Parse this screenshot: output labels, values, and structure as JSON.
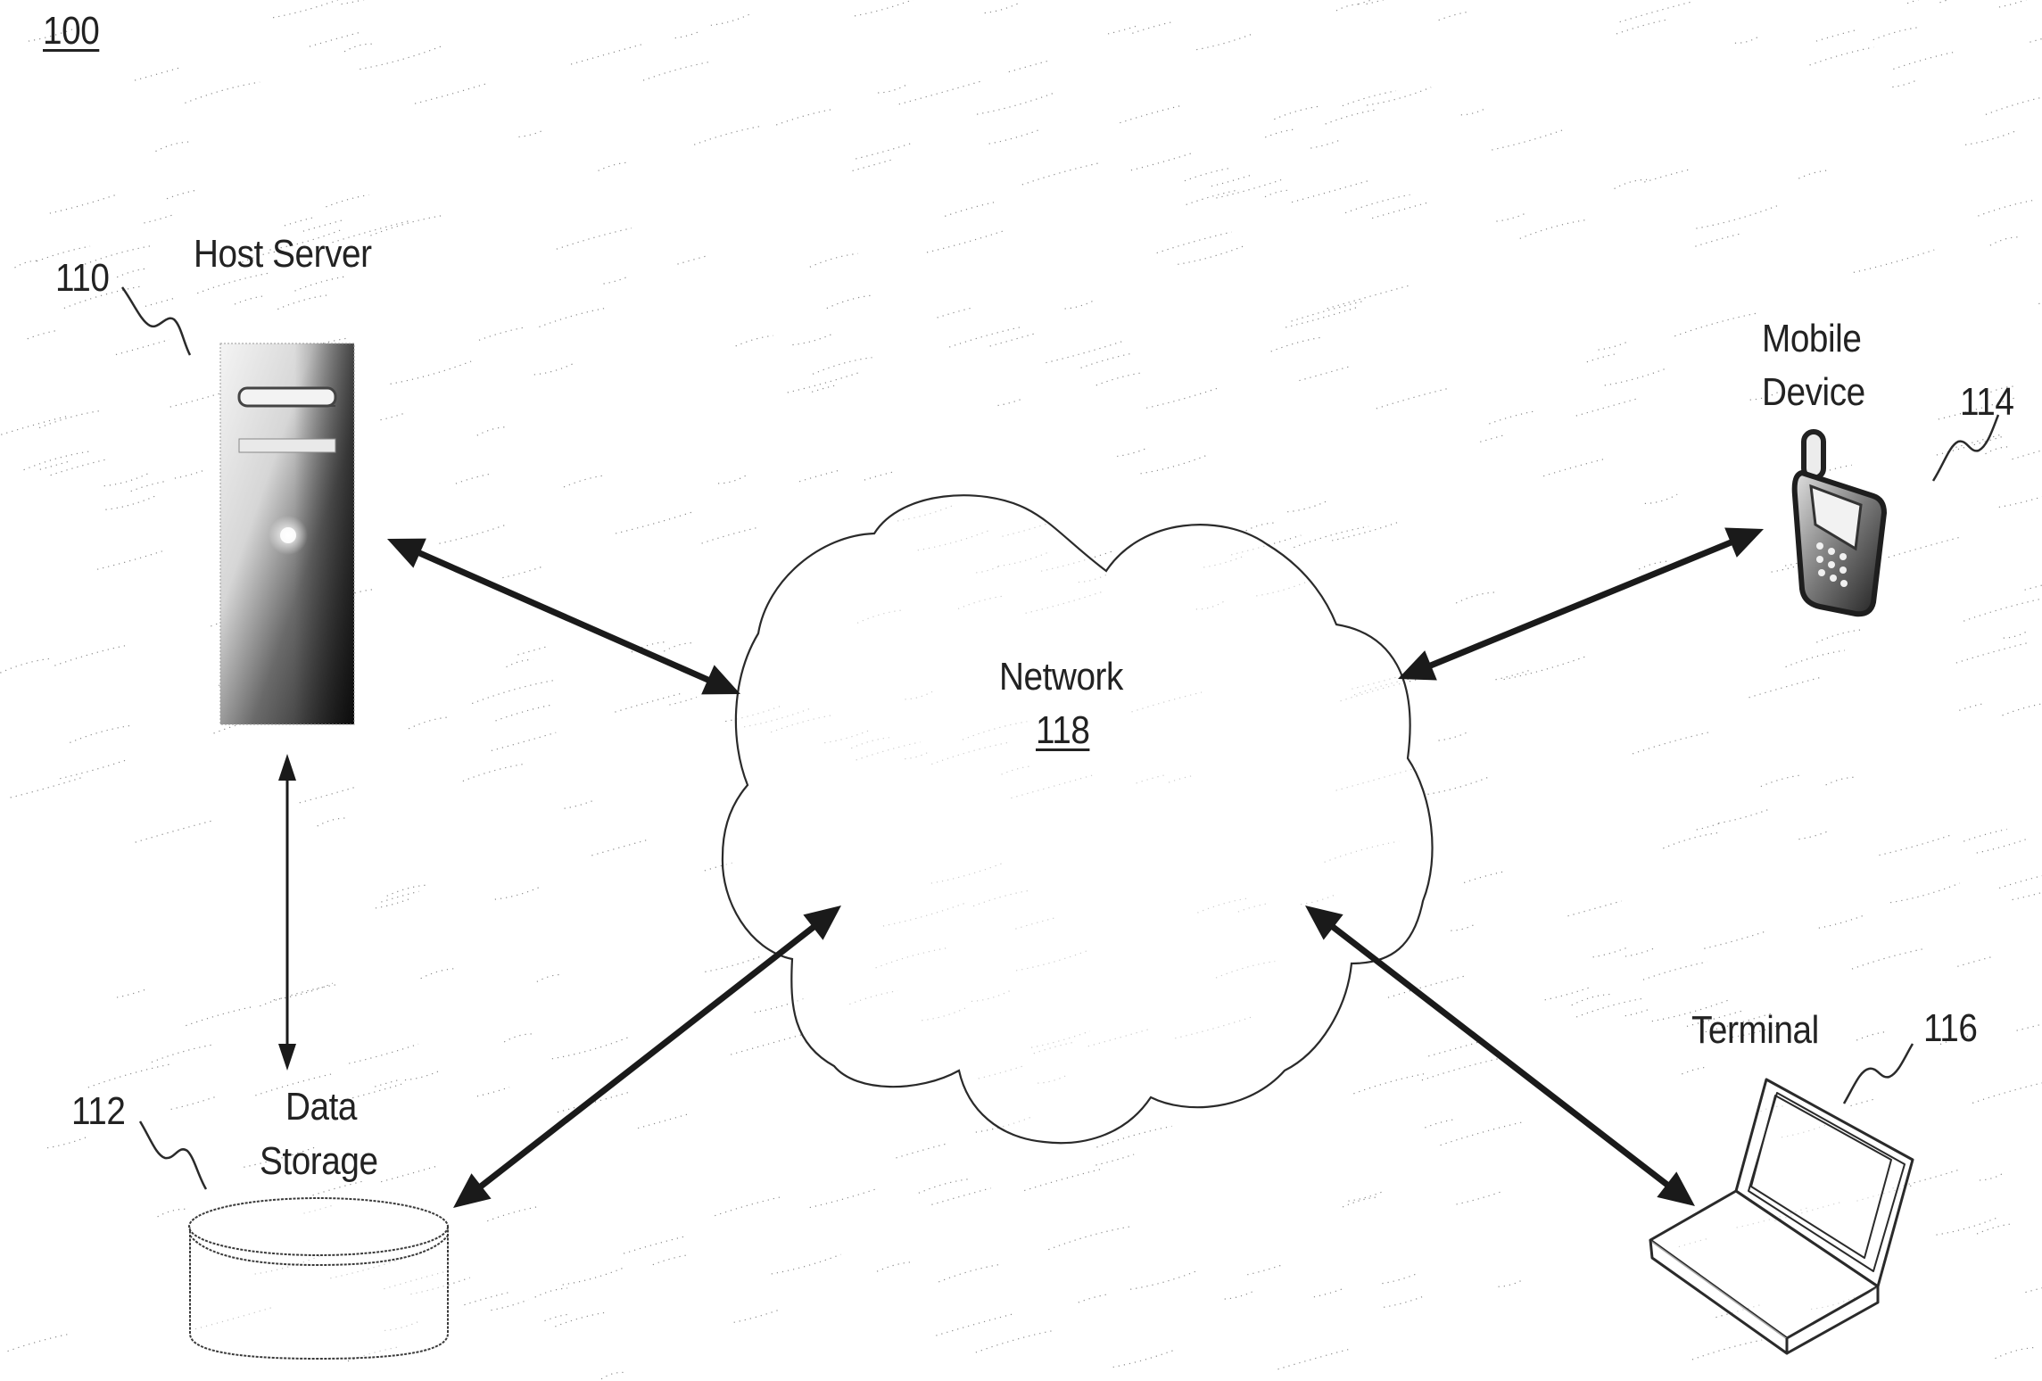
{
  "figure": {
    "number": "100",
    "colors": {
      "ink": "#1a1a1a",
      "stroke": "#2a2a2a",
      "background": "#ffffff",
      "stipple": "#8a8a8a"
    }
  },
  "nodes": {
    "host_server": {
      "label": "Host Server",
      "ref": "110",
      "icon": "server-tower-icon"
    },
    "data_storage": {
      "label_line1": "Data",
      "label_line2": "Storage",
      "ref": "112",
      "icon": "database-cylinder-icon"
    },
    "mobile_device": {
      "label_line1": "Mobile",
      "label_line2": "Device",
      "ref": "114",
      "icon": "mobile-phone-icon"
    },
    "terminal": {
      "label": "Terminal",
      "ref": "116",
      "icon": "laptop-icon"
    },
    "network": {
      "label": "Network",
      "ref": "118",
      "icon": "cloud-icon"
    }
  },
  "connections": [
    {
      "from": "host_server",
      "to": "network",
      "type": "bidirectional"
    },
    {
      "from": "host_server",
      "to": "data_storage",
      "type": "bidirectional"
    },
    {
      "from": "data_storage",
      "to": "network",
      "type": "bidirectional"
    },
    {
      "from": "mobile_device",
      "to": "network",
      "type": "bidirectional"
    },
    {
      "from": "terminal",
      "to": "network",
      "type": "bidirectional"
    }
  ]
}
